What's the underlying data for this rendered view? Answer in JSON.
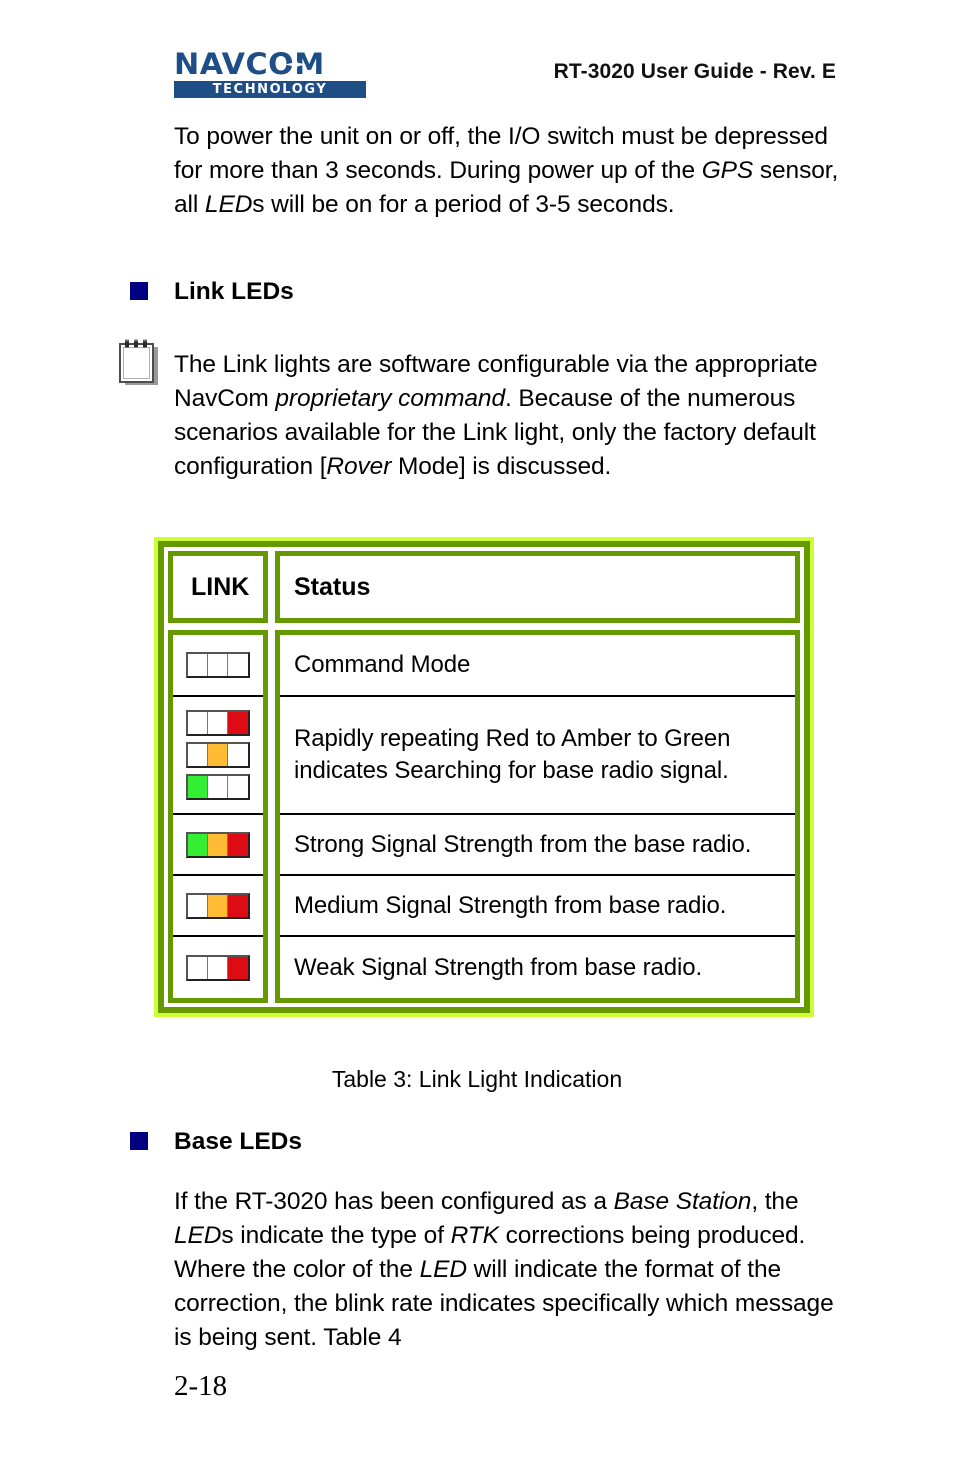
{
  "header": {
    "logo_word": "NAVCOM",
    "logo_sub": "TECHNOLOGY",
    "logo_star_icon": "star-icon",
    "title": "RT-3020 User Guide - Rev. E"
  },
  "intro_paragraph": {
    "segments": [
      {
        "text": "To power the unit on or off, the I/O switch must be depressed for more than 3 seconds. During power up of the ",
        "italic": false
      },
      {
        "text": "GPS",
        "italic": true
      },
      {
        "text": " sensor, all ",
        "italic": false
      },
      {
        "text": "LED",
        "italic": true
      },
      {
        "text": "s will be on for a period of 3-5 seconds.",
        "italic": false
      }
    ]
  },
  "link_leds_heading": "Link LEDs",
  "note_icon": "notepad-icon",
  "note_paragraph": {
    "segments": [
      {
        "text": "The Link lights are software configurable via the appropriate NavCom ",
        "italic": false
      },
      {
        "text": "proprietary command",
        "italic": true
      },
      {
        "text": ". Because of the numerous scenarios available for the Link light, only the factory default configuration [",
        "italic": false
      },
      {
        "text": "Rover",
        "italic": true
      },
      {
        "text": " Mode] is discussed.",
        "italic": false
      }
    ]
  },
  "table": {
    "headers": {
      "link": "LINK",
      "status": "Status"
    },
    "rows": [
      {
        "leds": [
          [
            "off",
            "off",
            "off"
          ]
        ],
        "status": "Command Mode"
      },
      {
        "leds": [
          [
            "off",
            "off",
            "red"
          ],
          [
            "off",
            "amber",
            "off"
          ],
          [
            "green",
            "off",
            "off"
          ]
        ],
        "status": "Rapidly repeating Red to Amber to Green indicates Searching for base radio signal."
      },
      {
        "leds": [
          [
            "green",
            "amber",
            "red"
          ]
        ],
        "status": "Strong Signal Strength from the base radio."
      },
      {
        "leds": [
          [
            "off",
            "amber",
            "red"
          ]
        ],
        "status": "Medium Signal Strength from base radio."
      },
      {
        "leds": [
          [
            "off",
            "off",
            "red"
          ]
        ],
        "status": "Weak Signal Strength from base radio."
      }
    ]
  },
  "caption": "Table 3: Link Light Indication",
  "base_leds_heading": "Base LEDs",
  "base_paragraph": {
    "segments": [
      {
        "text": "If the RT-3020 has been configured as a ",
        "italic": false
      },
      {
        "text": "Base Station",
        "italic": true
      },
      {
        "text": ", the ",
        "italic": false
      },
      {
        "text": "LED",
        "italic": true
      },
      {
        "text": "s indicate the type of ",
        "italic": false
      },
      {
        "text": "RTK",
        "italic": true
      },
      {
        "text": " corrections being produced. Where the color of the ",
        "italic": false
      },
      {
        "text": "LED",
        "italic": true
      },
      {
        "text": " will indicate the format of the correction, the blink rate indicates specifically which message is being sent. Table 4",
        "italic": false
      }
    ]
  },
  "page_number": "2-18",
  "colors": {
    "brand_blue": "#1F4E87",
    "bullet_navy": "#000080",
    "table_border_bright": "#CCFF33",
    "table_border_olive": "#669900",
    "led_green": "#33EE33",
    "led_amber": "#FFBB33",
    "led_red": "#DD0C14"
  }
}
